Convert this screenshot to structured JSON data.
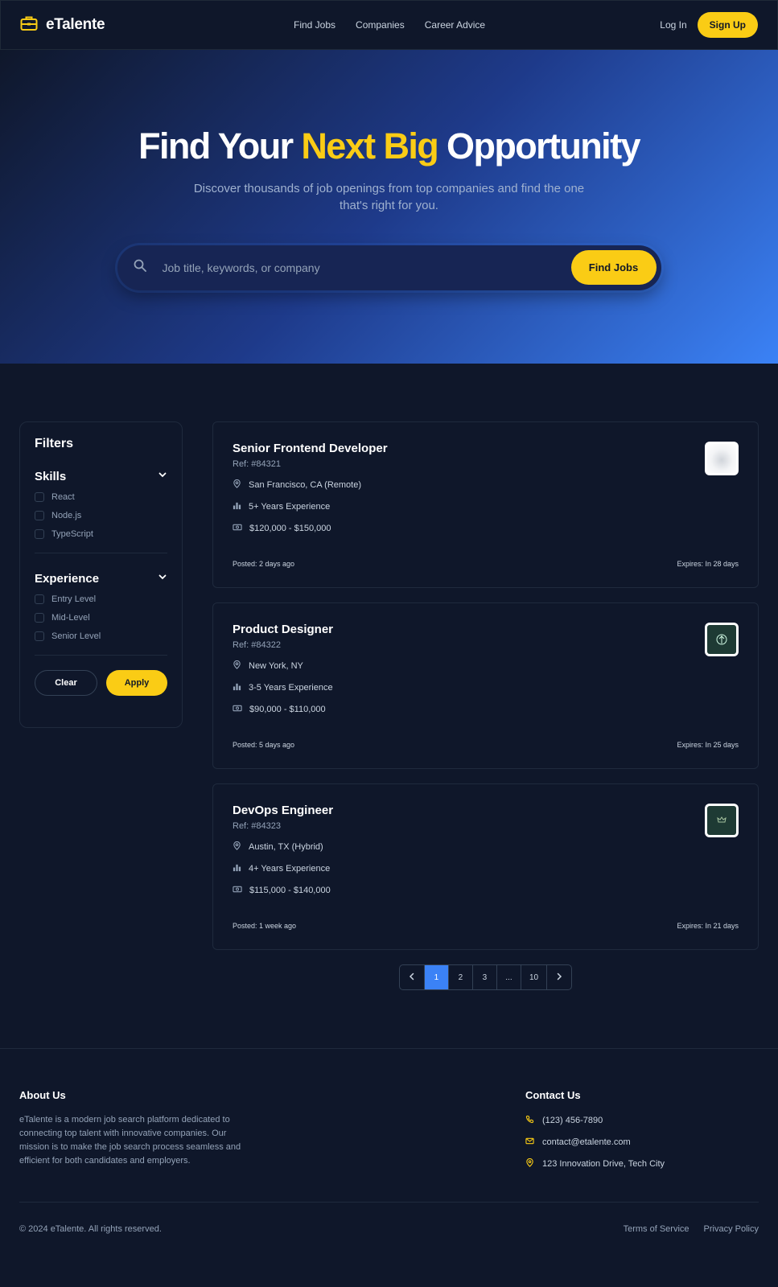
{
  "header": {
    "brand": "eTalente",
    "nav": [
      "Find Jobs",
      "Companies",
      "Career Advice"
    ],
    "login": "Log In",
    "signup": "Sign Up"
  },
  "hero": {
    "title_part1": "Find Your ",
    "title_highlight": "Next Big",
    "title_part2": " Opportunity",
    "subtitle": "Discover thousands of job openings from top companies and find the one that's right for you.",
    "search_placeholder": "Job title, keywords, or company",
    "search_button": "Find Jobs"
  },
  "filters": {
    "title": "Filters",
    "groups": [
      {
        "title": "Skills",
        "options": [
          "React",
          "Node.js",
          "TypeScript"
        ]
      },
      {
        "title": "Experience",
        "options": [
          "Entry Level",
          "Mid-Level",
          "Senior Level"
        ]
      }
    ],
    "clear": "Clear",
    "apply": "Apply"
  },
  "jobs": [
    {
      "title": "Senior Frontend Developer",
      "ref": "Ref: #84321",
      "location": "San Francisco, CA (Remote)",
      "experience": "5+ Years Experience",
      "salary": "$120,000 - $150,000",
      "posted": "Posted: 2 days ago",
      "expires": "Expires: In 28 days"
    },
    {
      "title": "Product Designer",
      "ref": "Ref: #84322",
      "location": "New York, NY",
      "experience": "3-5 Years Experience",
      "salary": "$90,000 - $110,000",
      "posted": "Posted: 5 days ago",
      "expires": "Expires: In 25 days"
    },
    {
      "title": "DevOps Engineer",
      "ref": "Ref: #84323",
      "location": "Austin, TX (Hybrid)",
      "experience": "4+ Years Experience",
      "salary": "$115,000 - $140,000",
      "posted": "Posted: 1 week ago",
      "expires": "Expires: In 21 days"
    }
  ],
  "pagination": [
    "1",
    "2",
    "3",
    "...",
    "10"
  ],
  "footer": {
    "about_title": "About Us",
    "about_text": "eTalente is a modern job search platform dedicated to connecting top talent with innovative companies. Our mission is to make the job search process seamless and efficient for both candidates and employers.",
    "contact_title": "Contact Us",
    "phone": "(123) 456-7890",
    "email": "contact@etalente.com",
    "address": "123 Innovation Drive, Tech City",
    "copyright": "© 2024 eTalente. All rights reserved.",
    "links": [
      "Terms of Service",
      "Privacy Policy"
    ]
  },
  "colors": {
    "accent": "#facc15",
    "primary": "#3b82f6",
    "background": "#0f172a"
  }
}
